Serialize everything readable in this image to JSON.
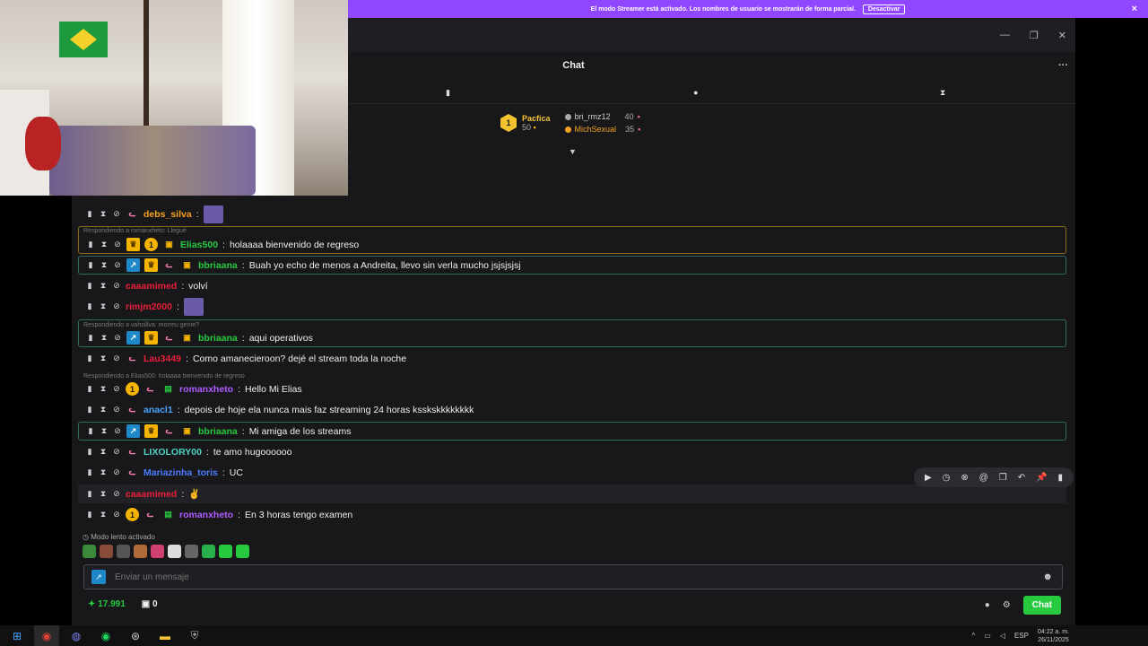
{
  "banner": {
    "text": "El modo Streamer está activado. Los nombres de usuario se mostrarán de forma parcial.",
    "button": "Desactivar",
    "close": "×"
  },
  "window": {
    "minimize": "—",
    "maximize": "❐",
    "close": "✕"
  },
  "chat": {
    "title": "Chat",
    "menu": "···"
  },
  "leaderboard": {
    "top": {
      "rank": "1",
      "name": "Pacfica",
      "points": "50"
    },
    "others": [
      {
        "name": "bri_rmz12",
        "points": "40",
        "color": "#aaaaaa"
      },
      {
        "name": "MichSexual",
        "points": "35",
        "color": "#f4a020"
      }
    ]
  },
  "messages": [
    {
      "user": "debs_silva",
      "color": "#f4a020",
      "text": "",
      "emote": true
    },
    {
      "reply": "Respondiendo a romanxheto: Llegué",
      "user": "Elias500",
      "color": "#27c93f",
      "text": "holaaaa bienvenido de regreso"
    },
    {
      "user": "bbriaana",
      "color": "#27c93f",
      "text": "Buah yo echo de menos a Andreita, llevo sin verla mucho jsjsjsjsj"
    },
    {
      "user": "caaamimed",
      "color": "#e91e3a",
      "text": "volví"
    },
    {
      "user": "rimjm2000",
      "color": "#e91e3a",
      "text": "",
      "emote": true
    },
    {
      "reply": "Respondiendo a vahsillva: morreu gente?",
      "user": "bbriaana",
      "color": "#27c93f",
      "text": "aqui operativos"
    },
    {
      "user": "Lau3449",
      "color": "#e91e3a",
      "text": "Como amanecieroon? dejé el stream toda la noche"
    },
    {
      "reply": "Respondiendo a Elias500: holaaaa bienvenido de regreso",
      "user": "romanxheto",
      "color": "#b05cff",
      "text": "Hello Mi Elias"
    },
    {
      "user": "anacl1",
      "color": "#4aa3ff",
      "text": "depois de hoje ela nunca mais faz streaming 24 horas ksskskkkkkkkk"
    },
    {
      "user": "bbriaana",
      "color": "#27c93f",
      "text": "Mi amiga de los streams"
    },
    {
      "user": "LIXOLORY00",
      "color": "#4fd1c5",
      "text": "te amo hugoooooo"
    },
    {
      "user": "Mariazinha_toris",
      "color": "#4a7cff",
      "text": "UC"
    },
    {
      "user": "caaamimed",
      "color": "#e91e3a",
      "text": ""
    },
    {
      "user": "romanxheto",
      "color": "#b05cff",
      "text": "En 3 horas tengo examen"
    }
  ],
  "slowmode": "Modo lento activado",
  "input": {
    "placeholder": "Enviar un mensaje"
  },
  "footer": {
    "points": "17.991",
    "bits": "0",
    "chat_button": "Chat"
  },
  "taskbar": {
    "lang": "ESP",
    "time": "04:22 a. m.",
    "date": "26/11/2025"
  }
}
